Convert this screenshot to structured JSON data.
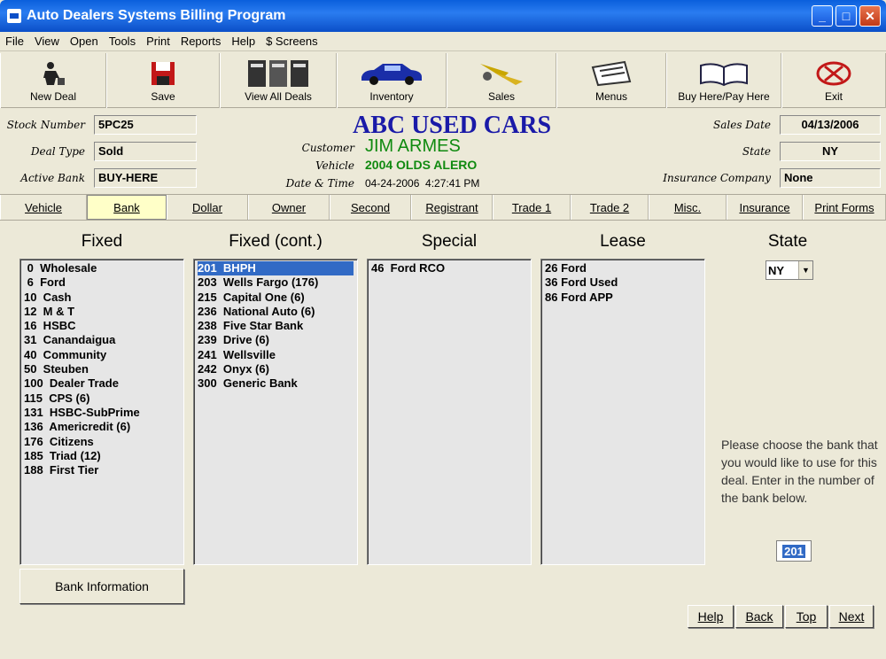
{
  "window": {
    "title": "Auto Dealers Systems Billing Program"
  },
  "menu": [
    "File",
    "View",
    "Open",
    "Tools",
    "Print",
    "Reports",
    "Help",
    "$ Screens"
  ],
  "toolbar": [
    {
      "label": "New Deal",
      "icon": "new-deal-icon"
    },
    {
      "label": "Save",
      "icon": "save-icon"
    },
    {
      "label": "View All Deals",
      "icon": "view-all-deals-icon"
    },
    {
      "label": "Inventory",
      "icon": "car-icon"
    },
    {
      "label": "Sales",
      "icon": "sales-icon"
    },
    {
      "label": "Menus",
      "icon": "menus-icon"
    },
    {
      "label": "Buy Here/Pay Here",
      "icon": "book-icon"
    },
    {
      "label": "Exit",
      "icon": "exit-icon"
    }
  ],
  "header": {
    "company": "ABC USED CARS",
    "stock_label": "Stock Number",
    "stock_value": "5PC25",
    "deal_type_label": "Deal Type",
    "deal_type_value": "Sold",
    "active_bank_label": "Active Bank",
    "active_bank_value": "BUY-HERE",
    "customer_label": "Customer",
    "customer_value": "JIM ARMES",
    "vehicle_label": "Vehicle",
    "vehicle_value": "2004 OLDS ALERO",
    "datetime_label": "Date & Time",
    "datetime_value": "04-24-2006  4:27:41 PM",
    "sales_date_label": "Sales Date",
    "sales_date_value": "04/13/2006",
    "state_label": "State",
    "state_value": "NY",
    "insurance_label": "Insurance Company",
    "insurance_value": "None"
  },
  "tabs": [
    "Vehicle",
    "Bank",
    "Dollar",
    "Owner",
    "Second",
    "Registrant",
    "Trade 1",
    "Trade 2",
    "Misc.",
    "Insurance",
    "Print Forms"
  ],
  "active_tab": "Bank",
  "columns": {
    "fixed": {
      "title": "Fixed",
      "items": [
        " 0  Wholesale",
        " 6  Ford",
        "10  Cash",
        "12  M & T",
        "16  HSBC",
        "31  Canandaigua",
        "40  Community",
        "50  Steuben",
        "100  Dealer Trade",
        "115  CPS (6)",
        "131  HSBC-SubPrime",
        "136  Americredit (6)",
        "176  Citizens",
        "185  Triad (12)",
        "188  First Tier"
      ]
    },
    "fixed_cont": {
      "title": "Fixed (cont.)",
      "items": [
        "201  BHPH",
        "203  Wells Fargo (176)",
        "215  Capital One (6)",
        "236  National Auto (6)",
        "238  Five Star Bank",
        "239  Drive (6)",
        "241  Wellsville",
        "242  Onyx (6)",
        "300  Generic Bank"
      ],
      "selected": 0
    },
    "special": {
      "title": "Special",
      "items": [
        "46  Ford RCO"
      ]
    },
    "lease": {
      "title": "Lease",
      "items": [
        "26 Ford",
        "36 Ford Used",
        "86 Ford APP"
      ]
    }
  },
  "state": {
    "title": "State",
    "value": "NY"
  },
  "instructions": "Please choose the bank that you would like to use for this deal. Enter in the number of the bank below.",
  "bank_number": "201",
  "buttons": {
    "bank_info": "Bank Information",
    "help": "Help",
    "back": "Back",
    "top": "Top",
    "next": "Next"
  },
  "colors": {
    "accent": "#316ac5",
    "company": "#1a1aa8",
    "green": "#108a10",
    "active_tab": "#ffffc8"
  }
}
